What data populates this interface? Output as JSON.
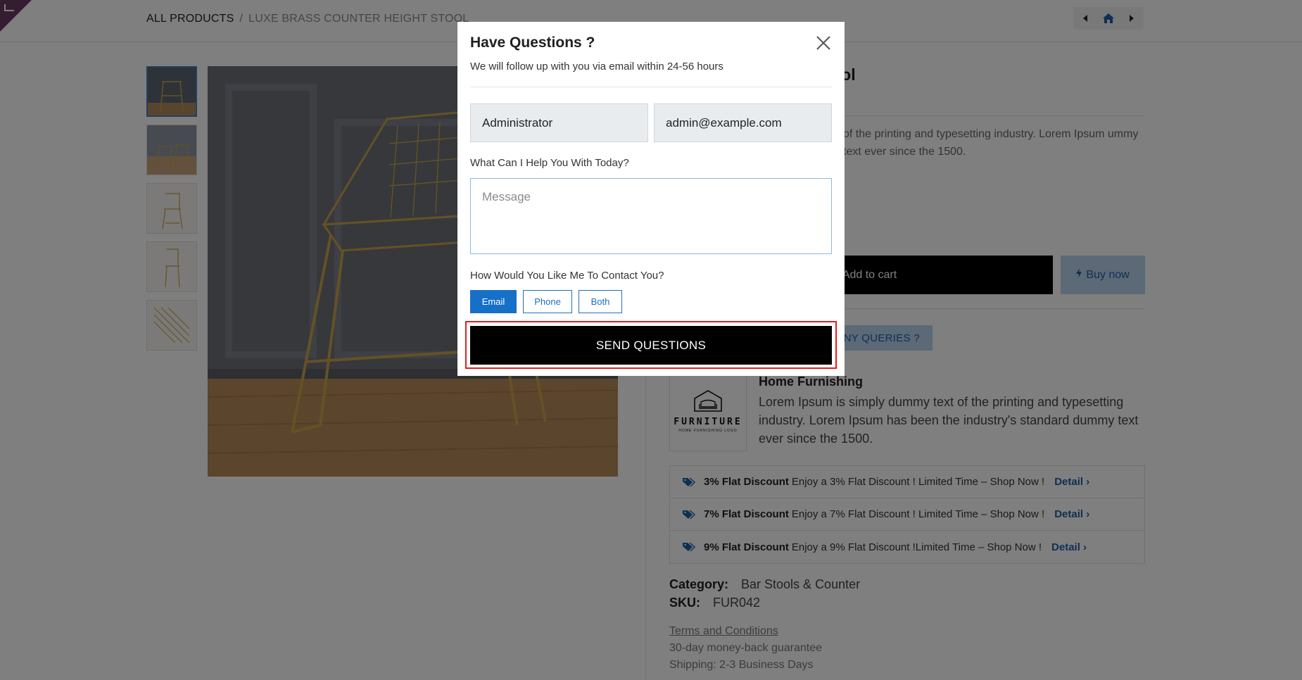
{
  "breadcrumb": {
    "root": "ALL PRODUCTS",
    "separator": "/",
    "current": "LUXE BRASS COUNTER HEIGHT STOOL"
  },
  "nav": {
    "prev_icon": "caret-left-icon",
    "home_icon": "home-icon",
    "next_icon": "caret-right-icon"
  },
  "product": {
    "title_visible": "ht Stool",
    "description_visible": "of the printing and typesetting industry. Lorem Ipsum ummy text ever since the 1500.",
    "add_to_cart": "Add to cart",
    "buy_now": "Buy now",
    "queries": "ANY QUERIES ?"
  },
  "brand": {
    "logo_word": "FURNITURE",
    "logo_sub": "HOME FURNISHING LOGO",
    "name": "Home Furnishing",
    "description": "Lorem Ipsum is simply dummy text of the printing and typesetting industry. Lorem Ipsum has been the industry's standard dummy text ever since the 1500."
  },
  "offers": [
    {
      "title": "3% Flat Discount",
      "text": "Enjoy a 3% Flat Discount ! Limited Time – Shop Now !",
      "link": "Detail"
    },
    {
      "title": "7% Flat Discount",
      "text": "Enjoy a 7% Flat Discount ! Limited Time – Shop Now !",
      "link": "Detail"
    },
    {
      "title": "9% Flat Discount",
      "text": "Enjoy a 9% Flat Discount !Limited Time – Shop Now !",
      "link": "Detail"
    }
  ],
  "meta": {
    "category_label": "Category:",
    "category_value": "Bar Stools & Counter",
    "sku_label": "SKU:",
    "sku_value": "FUR042"
  },
  "terms": {
    "link": "Terms and Conditions",
    "guarantee": "30-day money-back guarantee",
    "shipping": "Shipping: 2-3 Business Days"
  },
  "modal": {
    "title": "Have Questions ?",
    "subtitle": "We will follow up with you via email within 24-56 hours",
    "name_value": "Administrator",
    "email_value": "admin@example.com",
    "help_label": "What Can I Help You With Today?",
    "message_placeholder": "Message",
    "contact_label": "How Would You Like Me To Contact You?",
    "contact_options": [
      "Email",
      "Phone",
      "Both"
    ],
    "selected_option": "Email",
    "send_label": "SEND QUESTIONS"
  },
  "colors": {
    "accent": "#1670c8",
    "highlight_outline": "#e01f1f",
    "overlay": "rgba(0,0,0,0.5)"
  }
}
